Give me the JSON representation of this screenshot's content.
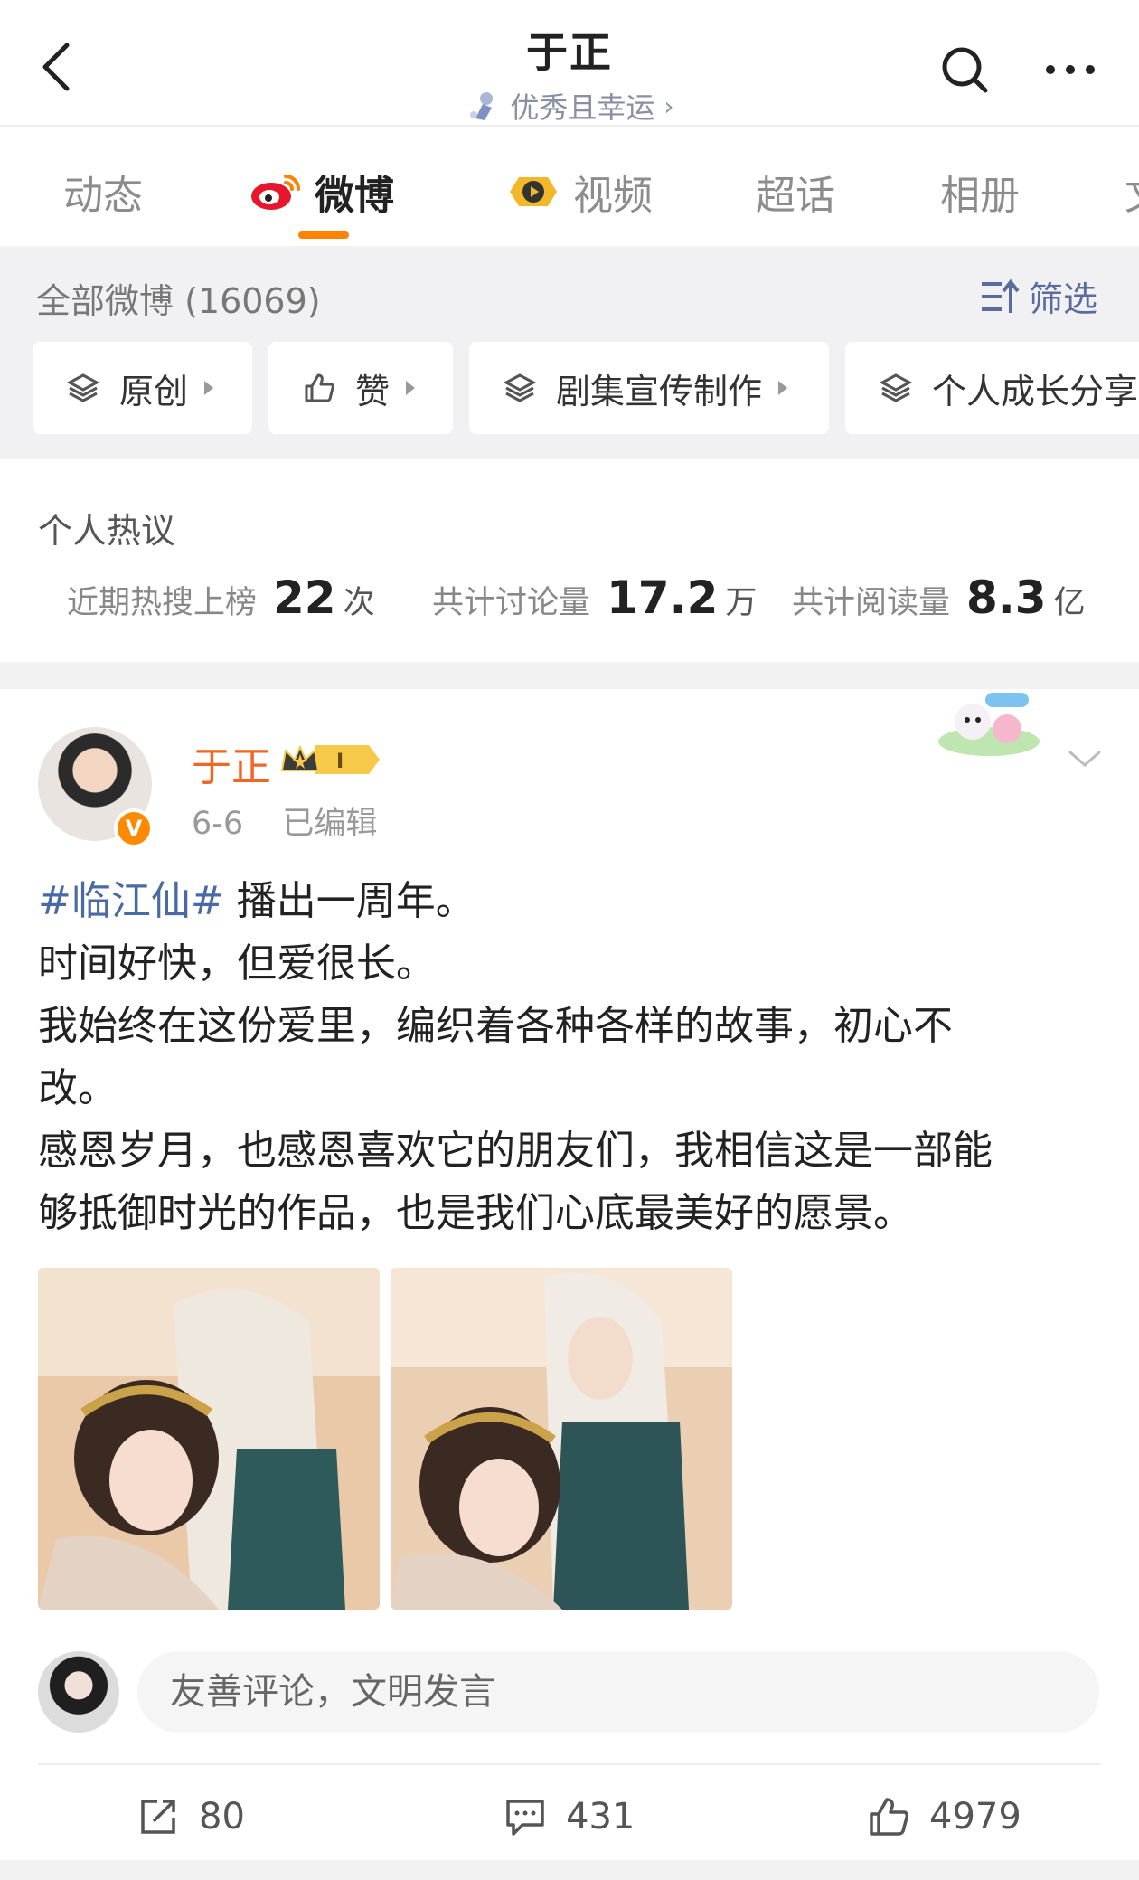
{
  "header": {
    "title": "于正",
    "subtitle": "优秀且幸运",
    "subtitle_chevron": "›"
  },
  "tabs": [
    {
      "label": "动态"
    },
    {
      "label": "微博"
    },
    {
      "label": "视频"
    },
    {
      "label": "超话"
    },
    {
      "label": "相册"
    },
    {
      "label": "文"
    }
  ],
  "filter": {
    "all_count": "全部微博 (16069)",
    "filter_label": "筛选",
    "chips": [
      {
        "label": "原创"
      },
      {
        "label": "赞"
      },
      {
        "label": "剧集宣传制作"
      },
      {
        "label": "个人成长分享"
      }
    ]
  },
  "hot": {
    "title": "个人热议",
    "stats": [
      {
        "label": "近期热搜上榜",
        "value": "22",
        "unit": "次"
      },
      {
        "label": "共计讨论量",
        "value": "17.2",
        "unit": "万"
      },
      {
        "label": "共计阅读量",
        "value": "8.3",
        "unit": "亿"
      }
    ]
  },
  "post": {
    "author": "于正",
    "verify_mark": "V",
    "date": "6-6",
    "edited": "已编辑",
    "hashtag": "#临江仙#",
    "lines": [
      " 播出一周年。",
      "时间好快，但爱很长。",
      "我始终在这份爱里，编织着各种各样的故事，初心不",
      "改。",
      "感恩岁月，也感恩喜欢它的朋友们，我相信这是一部能",
      "够抵御时光的作品，也是我们心底最美好的愿景。"
    ],
    "comment_placeholder": "友善评论，文明发言",
    "actions": {
      "reposts": "80",
      "comments": "431",
      "likes": "4979"
    }
  },
  "colors": {
    "accent": "#ff8200",
    "link": "#4a6aa5",
    "author": "#f26522"
  }
}
